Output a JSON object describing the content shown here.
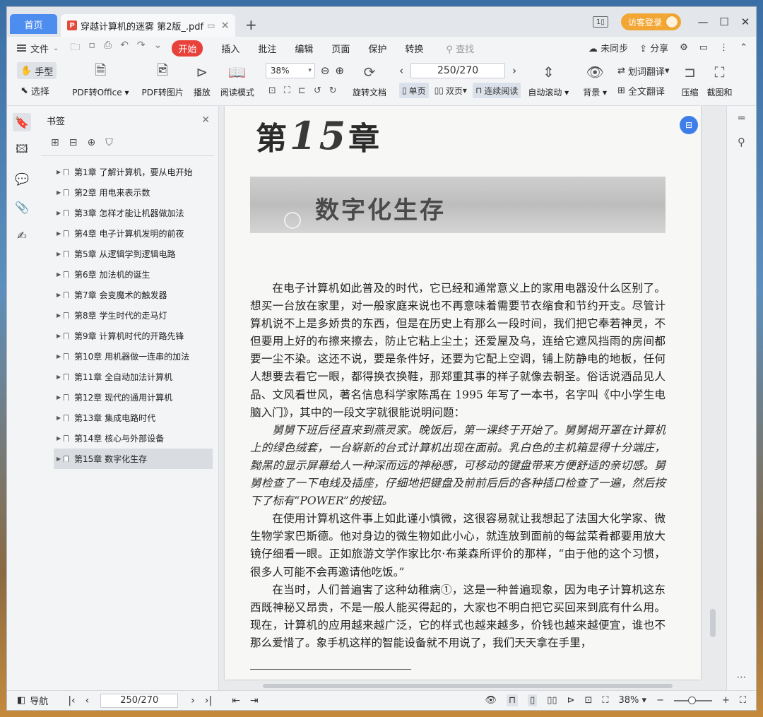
{
  "tabs": {
    "home": "首页",
    "doc_title": "穿越计算机的迷雾 第2版_.pdf",
    "login": "访客登录"
  },
  "menu": {
    "file": "文件",
    "start": "开始",
    "items": [
      "插入",
      "批注",
      "编辑",
      "页面",
      "保护",
      "转换"
    ],
    "search": "查找",
    "sync": "未同步",
    "share": "分享"
  },
  "ribbon": {
    "hand": "手型",
    "select": "选择",
    "pdf_office": "PDF转Office",
    "pdf_image": "PDF转图片",
    "play": "播放",
    "read_mode": "阅读模式",
    "zoom": "38%",
    "rotate": "旋转文档",
    "page": "250/270",
    "single": "单页",
    "double": "双页",
    "continuous": "连续阅读",
    "autoscroll": "自动滚动",
    "background": "背景",
    "word_translate": "划词翻译",
    "full_translate": "全文翻译",
    "compress": "压缩",
    "screenshot": "截图和"
  },
  "bookmarks": {
    "title": "书签",
    "items": [
      "第1章  了解计算机，要从电开始",
      "第2章  用电来表示数",
      "第3章  怎样才能让机器做加法",
      "第4章  电子计算机发明的前夜",
      "第5章  从逻辑学到逻辑电路",
      "第6章  加法机的诞生",
      "第7章  会变魔术的触发器",
      "第8章  学生时代的走马灯",
      "第9章  计算机时代的开路先锋",
      "第10章  用机器做一连串的加法",
      "第11章  全自动加法计算机",
      "第12章  现代的通用计算机",
      "第13章  集成电路时代",
      "第14章  核心与外部设备",
      "第15章  数字化生存"
    ]
  },
  "page": {
    "chapter_prefix": "第",
    "chapter_num": "15",
    "chapter_suffix": "章",
    "title": "数字化生存",
    "p1": "在电子计算机如此普及的时代，它已经和通常意义上的家用电器没什么区别了。想买一台放在家里，对一般家庭来说也不再意味着需要节衣缩食和节约开支。尽管计算机说不上是多娇贵的东西，但是在历史上有那么一段时间，我们把它奉若神灵，不但要用上好的布擦来擦去，防止它粘上尘土；还爱屋及乌，连给它遮风挡雨的房间都要一尘不染。这还不说，要是条件好，还要为它配上空调，铺上防静电的地板，任何人想要去看它一眼，都得换衣换鞋，那郑重其事的样子就像去朝圣。俗话说酒品见人品、文风看世风，著名信息科学家陈禹在 1995 年写了一本书，名字叫《中小学生电脑入门》，其中的一段文字就很能说明问题：",
    "p2": "舅舅下班后径直来到燕灵家。晚饭后，第一课终于开始了。舅舅揭开罩在计算机上的绿色绒套，一台崭新的台式计算机出现在面前。乳白色的主机箱显得十分端庄，黝黑的显示屏幕给人一种深而远的神秘感，可移动的键盘带来方便舒适的亲切感。舅舅检查了一下电线及插座，仔细地把键盘及前前后后的各种插口检查了一遍，然后按下了标有“POWER”的按钮。",
    "p3": "在使用计算机这件事上如此谨小慎微，这很容易就让我想起了法国大化学家、微生物学家巴斯德。他对身边的微生物如此小心，就连放到面前的每盆菜肴都要用放大镜仔细看一眼。正如旅游文学作家比尔·布莱森所评价的那样，“由于他的这个习惯，很多人可能不会再邀请他吃饭。”",
    "p4": "在当时，人们普遍害了这种幼稚病①，这是一种普遍现象，因为电子计算机这东西既神秘又昂贵，不是一般人能买得起的，大家也不明白把它买回来到底有什么用。现在，计算机的应用越来越广泛，它的样式也越来越多，价钱也越来越便宜，谁也不那么爱惜了。象手机这样的智能设备就不用说了，我们天天拿在手里，"
  },
  "status": {
    "nav": "导航",
    "page": "250/270",
    "zoom": "38%"
  }
}
